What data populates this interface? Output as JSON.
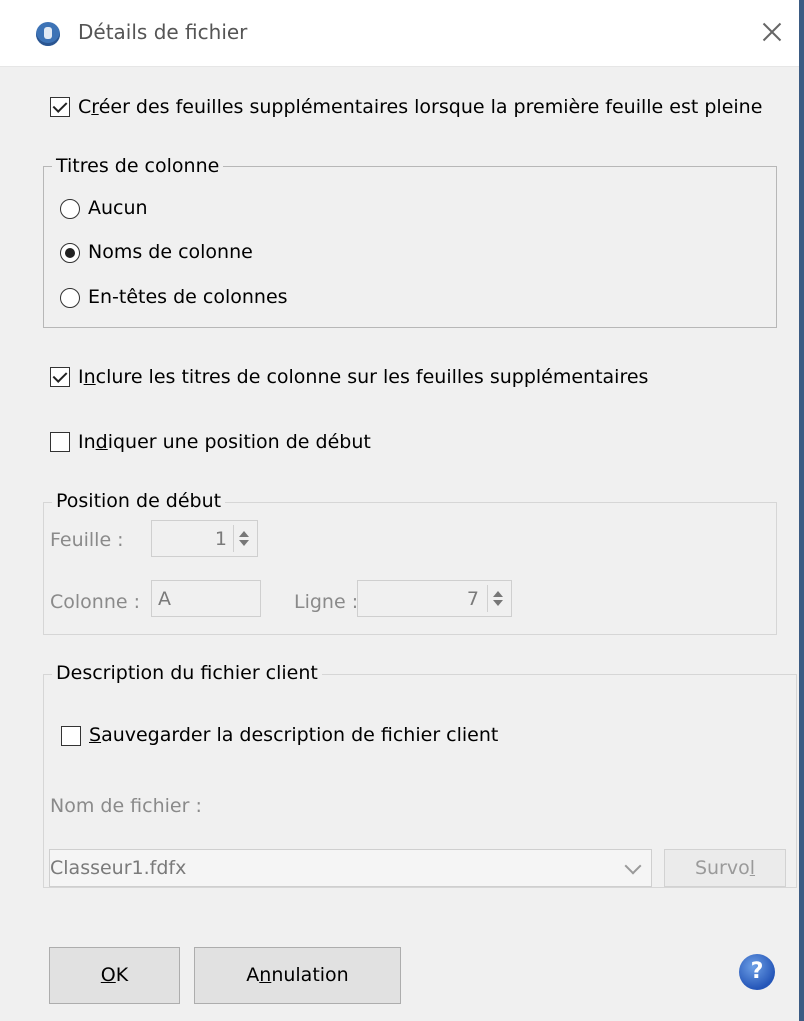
{
  "window": {
    "title": "Détails de fichier",
    "close_glyph": "✕"
  },
  "options": {
    "create_sheets": {
      "pre": "C",
      "u": "r",
      "post": "éer des feuilles supplémentaires lorsque la première feuille est pleine",
      "checked": true
    },
    "include_titles": {
      "pre": "I",
      "u": "n",
      "post": "clure les titres de colonne sur les feuilles supplémentaires",
      "checked": true
    },
    "start_position": {
      "pre": "In",
      "u": "d",
      "post": "iquer une position de début",
      "checked": false
    }
  },
  "column_titles": {
    "legend": "Titres de colonne",
    "options": [
      "Aucun",
      "Noms de colonne",
      "En-têtes de colonnes"
    ],
    "selected": "Noms de colonne"
  },
  "start_pos": {
    "legend": "Position de début",
    "sheet_label": "Feuille :",
    "sheet_value": "1",
    "column_label": "Colonne :",
    "column_value": "A",
    "row_label": "Ligne :",
    "row_value": "7"
  },
  "client_file": {
    "legend": "Description du fichier client",
    "save_desc": {
      "pre": "",
      "u": "S",
      "post": "auvegarder la description de fichier client",
      "checked": false
    },
    "filename_label": "Nom de fichier :",
    "filename_value": "Classeur1.fdfx",
    "browse": {
      "pre": "Survo",
      "u": "l",
      "post": ""
    }
  },
  "buttons": {
    "ok": {
      "pre": "",
      "u": "O",
      "post": "K"
    },
    "cancel": {
      "pre": "A",
      "u": "n",
      "post": "nulation"
    },
    "help_glyph": "?"
  },
  "colors": {
    "accent": "#2556b8",
    "window_edge": "#3b5b83"
  }
}
